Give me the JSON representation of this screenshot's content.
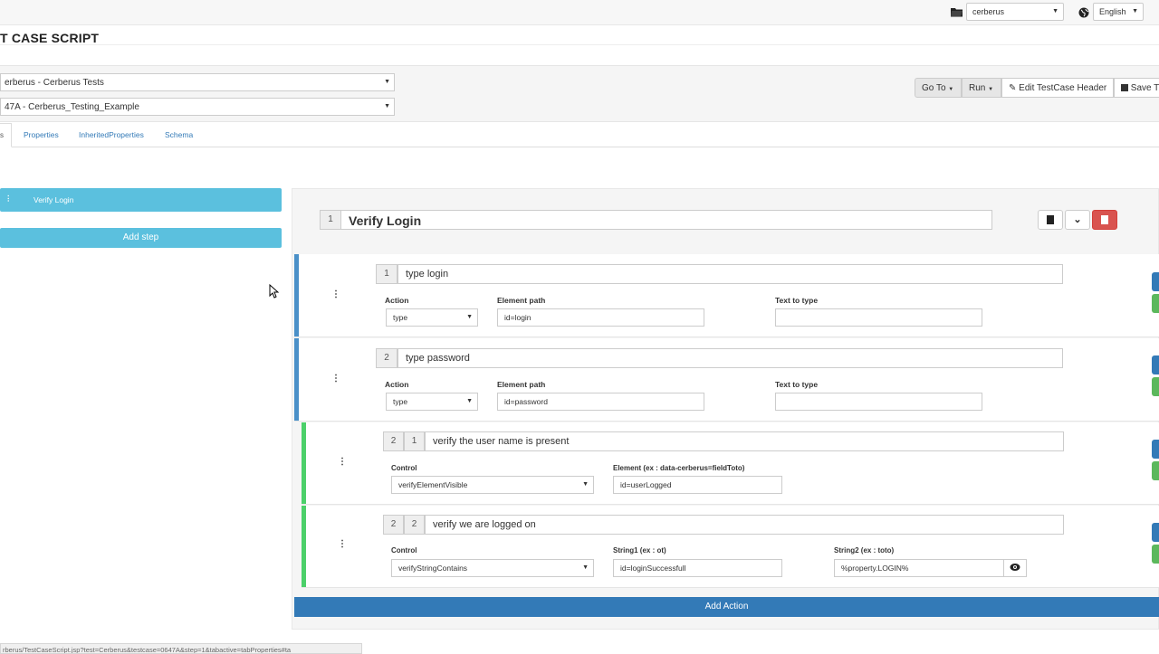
{
  "topbar": {
    "system_select": "cerberus",
    "language_select": "English"
  },
  "page_title": "T CASE SCRIPT",
  "header": {
    "test_select": "erberus - Cerberus Tests",
    "testcase_select": "47A - Cerberus_Testing_Example",
    "goto_label": "Go To",
    "run_label": "Run",
    "edit_header_label": "Edit TestCase Header",
    "save_label": "Save T"
  },
  "tabs": {
    "active": "s",
    "properties": "Properties",
    "inherited": "InheritedProperties",
    "schema": "Schema"
  },
  "steps": {
    "items": [
      {
        "label": "Verify Login"
      }
    ],
    "add_step_label": "Add step"
  },
  "step": {
    "number": "1",
    "title": "Verify Login"
  },
  "actions": [
    {
      "number": "1",
      "description": "type login",
      "action_label": "Action",
      "action_value": "type",
      "path_label": "Element path",
      "path_value": "id=login",
      "text_label": "Text to type",
      "text_value": ""
    },
    {
      "number": "2",
      "description": "type password",
      "action_label": "Action",
      "action_value": "type",
      "path_label": "Element path",
      "path_value": "id=password",
      "text_label": "Text to type",
      "text_value": ""
    }
  ],
  "controls": [
    {
      "action_number": "2",
      "number": "1",
      "description": "verify the user name is present",
      "control_label": "Control",
      "control_value": "verifyElementVisible",
      "element_label": "Element (ex : data-cerberus=fieldToto)",
      "element_value": "id=userLogged"
    },
    {
      "action_number": "2",
      "number": "2",
      "description": "verify we are logged on",
      "control_label": "Control",
      "control_value": "verifyStringContains",
      "string1_label": "String1 (ex : ot)",
      "string1_value": "id=loginSuccessfull",
      "string2_label": "String2 (ex : toto)",
      "string2_value": "%property.LOGIN%"
    }
  ],
  "add_action_label": "Add Action",
  "status_url": "rberus/TestCaseScript.jsp?test=Cerberus&testcase=0647A&step=1&tabactive=tabProperties#ta",
  "colors": {
    "step_info": "#5bc0de",
    "primary": "#337ab7",
    "action_bar": "#4a90c8",
    "control_bar": "#4cd06a",
    "danger": "#d9534f"
  }
}
